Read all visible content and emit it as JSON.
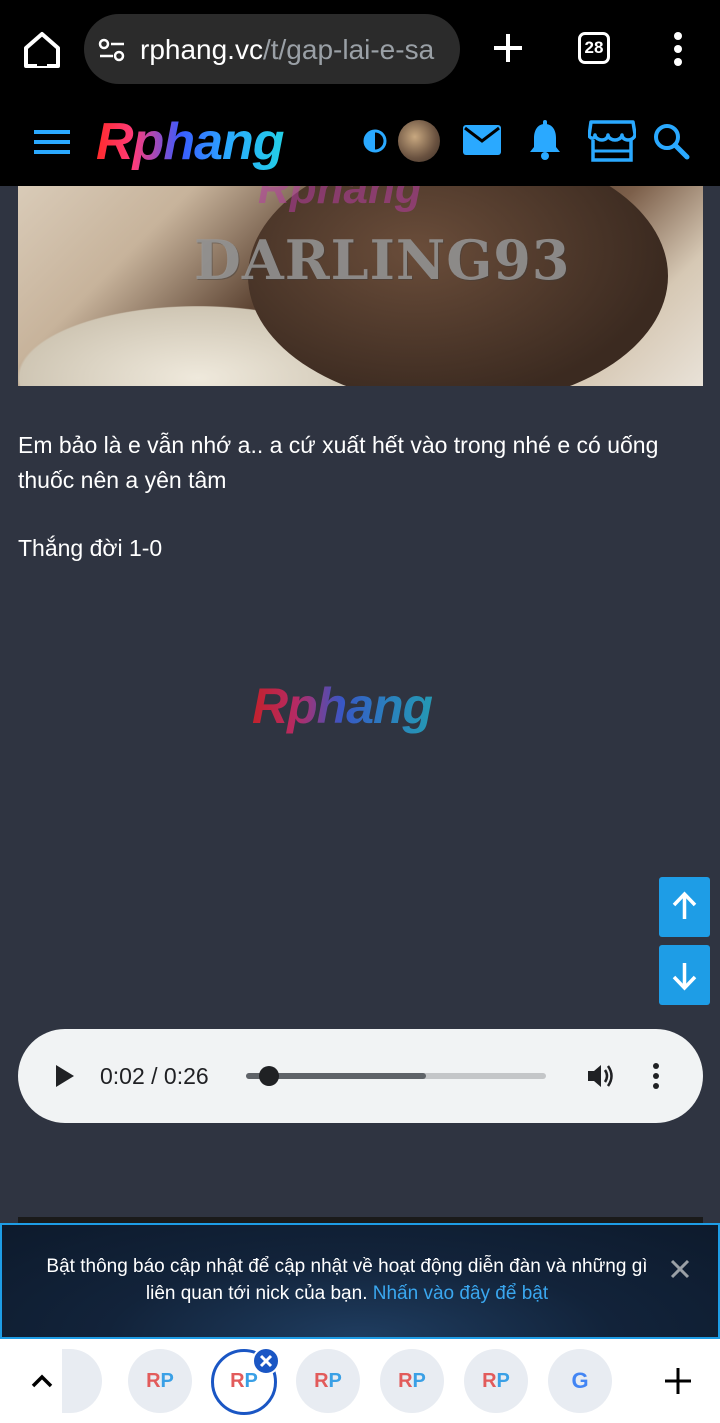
{
  "browser": {
    "url_host": "rphang.vc",
    "url_path": "/t/gap-lai-e-sa",
    "tab_count": "28"
  },
  "site_header": {
    "logo_text": "Rphang"
  },
  "post": {
    "image_watermark": "DARLING93",
    "image_logo": "Rphang",
    "paragraph_1": "Em bảo là e vẫn nhớ a.. a cứ xuất hết vào trong nhé e có uống thuốc nên a yên tâm",
    "paragraph_2": "Thắng đời 1-0",
    "center_logo": "Rphang"
  },
  "audio": {
    "time": "0:02 / 0:26",
    "played_fraction": 0.077,
    "buffered_fraction": 0.6
  },
  "notification": {
    "message": "Bật thông báo cập nhật để cập nhật về hoạt động diễn đàn và những gì liên quan tới nick của bạn.",
    "link_text": "Nhấn vào đây để bật"
  },
  "tab_strip": {
    "tabs": [
      {
        "label_r": "R",
        "label_p": "P"
      },
      {
        "label_r": "R",
        "label_p": "P"
      },
      {
        "label_r": "R",
        "label_p": "P"
      },
      {
        "label_r": "R",
        "label_p": "P"
      },
      {
        "label_r": "R",
        "label_p": "P"
      }
    ],
    "google_label": "G"
  },
  "colors": {
    "accent_blue": "#1e9de6",
    "page_bg": "#2f3441",
    "link_blue": "#3aa7ef"
  },
  "icons": [
    "home-icon",
    "site-info-icon",
    "plus-icon",
    "tabs-icon",
    "more-vert-icon",
    "hamburger-icon",
    "contrast-icon",
    "mail-icon",
    "bell-icon",
    "store-icon",
    "search-icon",
    "arrow-up-icon",
    "arrow-down-icon",
    "play-icon",
    "volume-icon",
    "close-icon",
    "chevron-up-icon"
  ]
}
